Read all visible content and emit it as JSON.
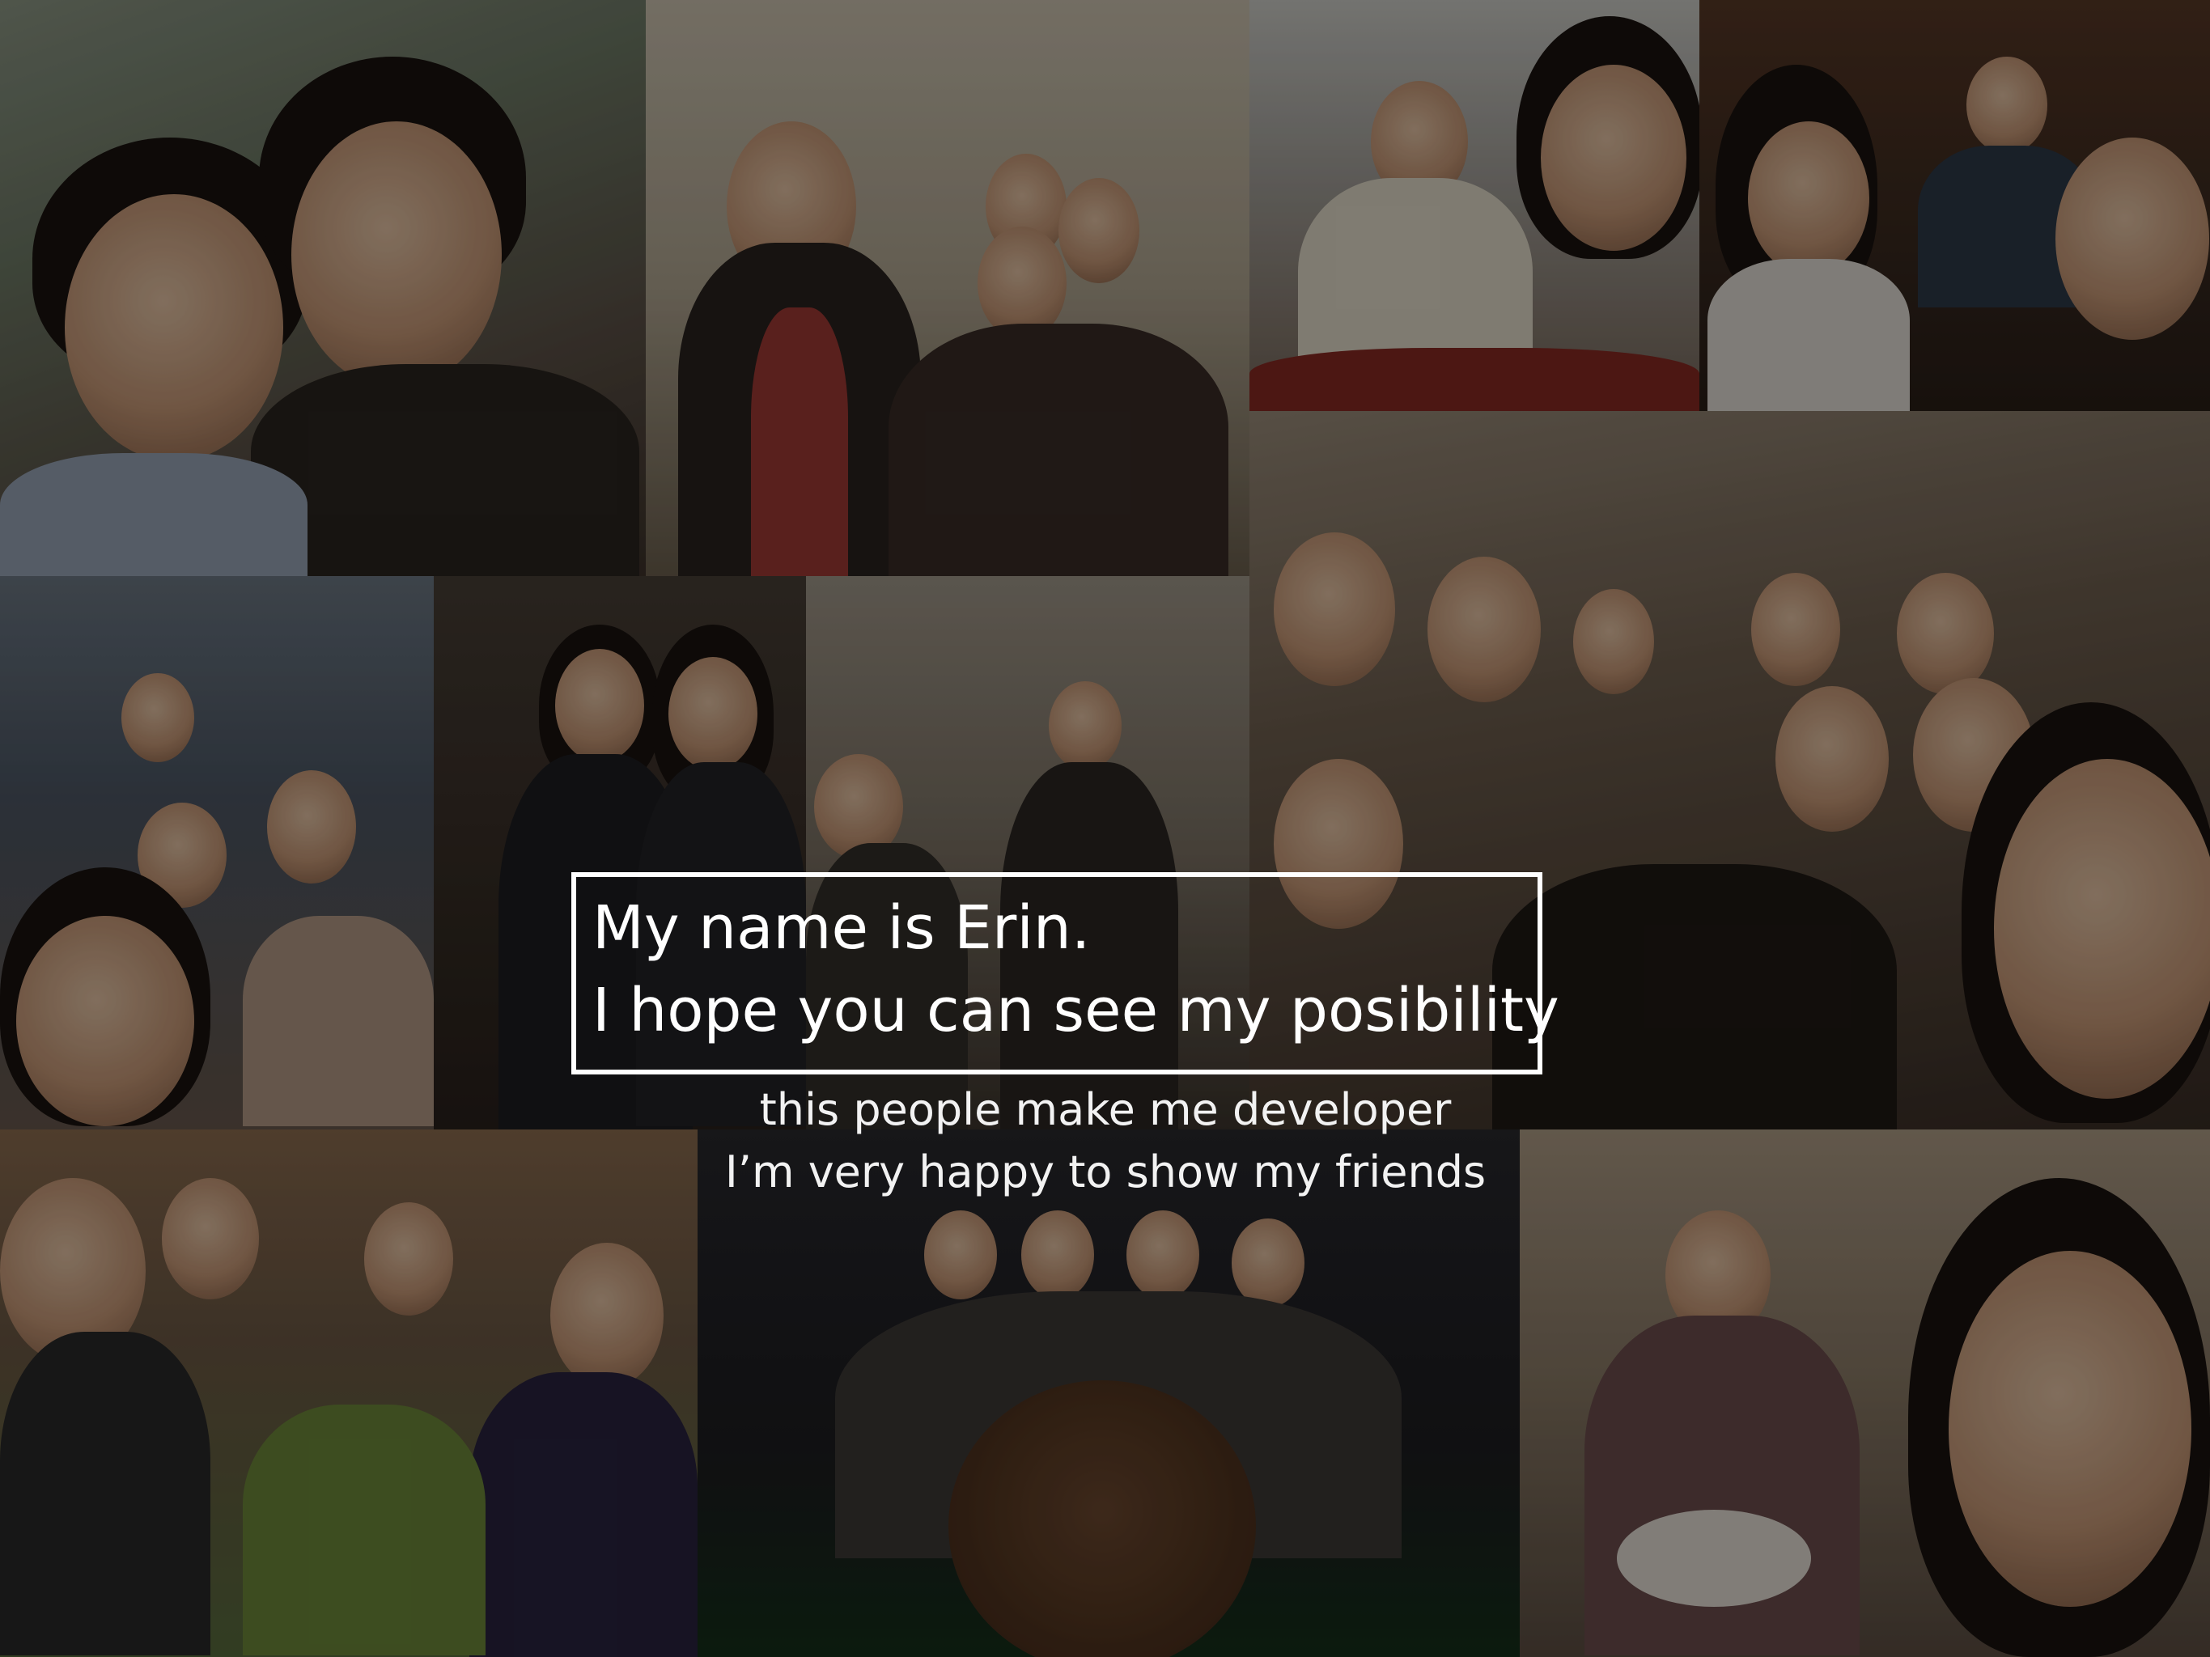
{
  "slide": {
    "title_line1": "My name is Erin.",
    "title_line2": "I hope you can see my posibility",
    "subtitle_line1": "this people make me developer",
    "subtitle_line2": "I’m very happy to show my friends"
  },
  "colors": {
    "background": "#1a1712",
    "text": "#ffffff",
    "border": "#ffffff"
  },
  "photos": [
    "selfie-two-friends-outdoor",
    "group-with-teacher",
    "cafe-peace-sign",
    "cafe-laptop-group",
    "restaurant-large-group",
    "group-lying-down",
    "mirror-selfie-pair",
    "guitar-room",
    "library-group-laptops",
    "group-with-bear-plush",
    "restaurant-noodle-selfie"
  ]
}
